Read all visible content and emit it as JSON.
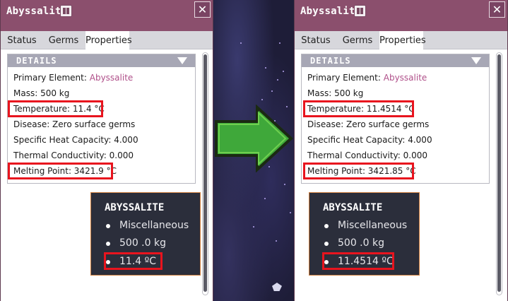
{
  "before": {
    "title": "Abyssalite",
    "tabs": [
      "Status",
      "Germs",
      "Properties"
    ],
    "active_tab": "Properties",
    "details_header": "DETAILS",
    "primary_element_label": "Primary Element:",
    "primary_element_value": "Abyssalite",
    "mass": "Mass: 500 kg",
    "temperature": "Temperature: 11.4 °C",
    "disease": "Disease: Zero surface germs",
    "specific_heat": "Specific Heat Capacity: 4.000",
    "thermal_conductivity": "Thermal Conductivity: 0.000",
    "melting_point": "Melting Point: 3421.9 °C",
    "tooltip": {
      "title": "ABYSSALITE",
      "category": "Miscellaneous",
      "mass": "500 .0 kg",
      "temperature": "11.4 ºC"
    }
  },
  "after": {
    "title": "Abyssalite",
    "tabs": [
      "Status",
      "Germs",
      "Properties"
    ],
    "active_tab": "Properties",
    "details_header": "DETAILS",
    "primary_element_label": "Primary Element:",
    "primary_element_value": "Abyssalite",
    "mass": "Mass: 500 kg",
    "temperature": "Temperature: 11.4514 °C",
    "disease": "Disease: Zero surface germs",
    "specific_heat": "Specific Heat Capacity: 4.000",
    "thermal_conductivity": "Thermal Conductivity: 0.000",
    "melting_point": "Melting Point: 3421.85 °C",
    "tooltip": {
      "title": "ABYSSALITE",
      "category": "Miscellaneous",
      "mass": "500 .0 kg",
      "temperature": "11.4514 ºC"
    }
  },
  "icons": {
    "book": "book-icon",
    "close": "close-icon",
    "collapse": "chevron-down-icon",
    "arrow": "arrow-right-icon"
  },
  "colors": {
    "titlebar": "#8b4f6d",
    "element_link": "#b0508a",
    "highlight": "#e8141e",
    "arrow": "#3fa83a"
  },
  "close_symbol": "✕"
}
